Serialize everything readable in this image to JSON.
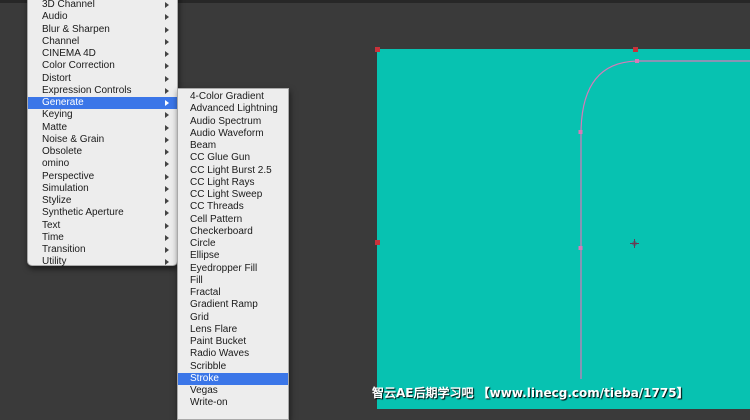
{
  "effects_menu": {
    "items": [
      {
        "label": "3D Channel",
        "submenu": true
      },
      {
        "label": "Audio",
        "submenu": true
      },
      {
        "label": "Blur & Sharpen",
        "submenu": true
      },
      {
        "label": "Channel",
        "submenu": true
      },
      {
        "label": "CINEMA 4D",
        "submenu": true
      },
      {
        "label": "Color Correction",
        "submenu": true
      },
      {
        "label": "Distort",
        "submenu": true
      },
      {
        "label": "Expression Controls",
        "submenu": true
      },
      {
        "label": "Generate",
        "submenu": true,
        "selected": true
      },
      {
        "label": "Keying",
        "submenu": true
      },
      {
        "label": "Matte",
        "submenu": true
      },
      {
        "label": "Noise & Grain",
        "submenu": true
      },
      {
        "label": "Obsolete",
        "submenu": true
      },
      {
        "label": "omino",
        "submenu": true
      },
      {
        "label": "Perspective",
        "submenu": true
      },
      {
        "label": "Simulation",
        "submenu": true
      },
      {
        "label": "Stylize",
        "submenu": true
      },
      {
        "label": "Synthetic Aperture",
        "submenu": true
      },
      {
        "label": "Text",
        "submenu": true
      },
      {
        "label": "Time",
        "submenu": true
      },
      {
        "label": "Transition",
        "submenu": true
      },
      {
        "label": "Utility",
        "submenu": true
      }
    ]
  },
  "generate_submenu": {
    "items": [
      {
        "label": "4-Color Gradient"
      },
      {
        "label": "Advanced Lightning"
      },
      {
        "label": "Audio Spectrum"
      },
      {
        "label": "Audio Waveform"
      },
      {
        "label": "Beam"
      },
      {
        "label": "CC Glue Gun"
      },
      {
        "label": "CC Light Burst 2.5"
      },
      {
        "label": "CC Light Rays"
      },
      {
        "label": "CC Light Sweep"
      },
      {
        "label": "CC Threads"
      },
      {
        "label": "Cell Pattern"
      },
      {
        "label": "Checkerboard"
      },
      {
        "label": "Circle"
      },
      {
        "label": "Ellipse"
      },
      {
        "label": "Eyedropper Fill"
      },
      {
        "label": "Fill"
      },
      {
        "label": "Fractal"
      },
      {
        "label": "Gradient Ramp"
      },
      {
        "label": "Grid"
      },
      {
        "label": "Lens Flare"
      },
      {
        "label": "Paint Bucket"
      },
      {
        "label": "Radio Waves"
      },
      {
        "label": "Scribble"
      },
      {
        "label": "Stroke",
        "selected": true
      },
      {
        "label": "Vegas"
      },
      {
        "label": "Write-on"
      }
    ]
  },
  "watermark": {
    "text": "智云AE后期学习吧 【www.linecg.com/tieba/1775】"
  },
  "colors": {
    "canvas": "#07c2b1",
    "selection": "#3b76e8",
    "path": "#d77ab8",
    "handle": "#c8323a"
  }
}
